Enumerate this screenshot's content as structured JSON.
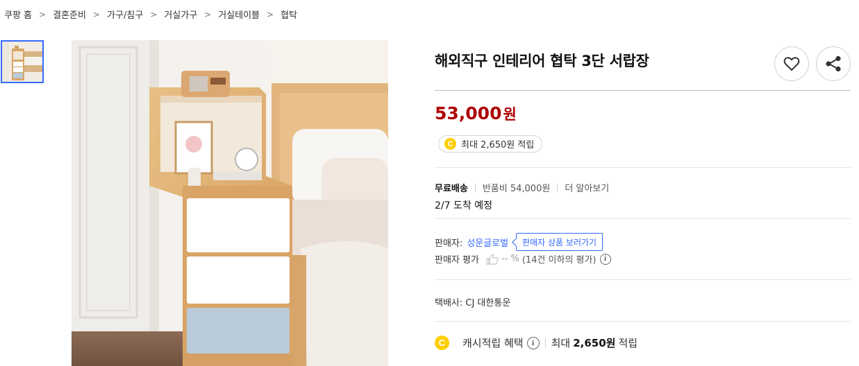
{
  "breadcrumb": [
    "쿠팡 홈",
    "결혼준비",
    "가구/침구",
    "거실가구",
    "거실테이블",
    "협탁"
  ],
  "breadcrumb_separator": ">",
  "product": {
    "title": "해외직구 인테리어 협탁 3단 서랍장",
    "price_amount": "53,000",
    "price_unit": "원"
  },
  "cash_badge": {
    "coin_letter": "C",
    "text": "최대 2,650원 적립"
  },
  "shipping": {
    "free_label": "무료배송",
    "return_fee": "반품비 54,000원",
    "more_link": "더 알아보기",
    "arrival": "2/7 도착 예정"
  },
  "seller": {
    "label": "판매자:",
    "name": "성운글로벌",
    "store_button": "판매자 상품 보러가기",
    "rating_label": "판매자 평가",
    "rating_value": "-- %",
    "rating_note": "(14건 이하의 평가)"
  },
  "courier": "택배사: CJ 대한통운",
  "cash_benefit": {
    "coin_letter": "C",
    "label": "캐시적립 혜택",
    "prefix": "최대",
    "amount": "2,650원",
    "suffix": "적립"
  },
  "icons": {
    "wishlist": "heart-icon",
    "share": "share-icon",
    "thumbs_up": "thumbs-up-icon",
    "info": "info-icon"
  },
  "colors": {
    "price": "#ae0000",
    "link": "#346aff",
    "coin": "#ffce00"
  }
}
